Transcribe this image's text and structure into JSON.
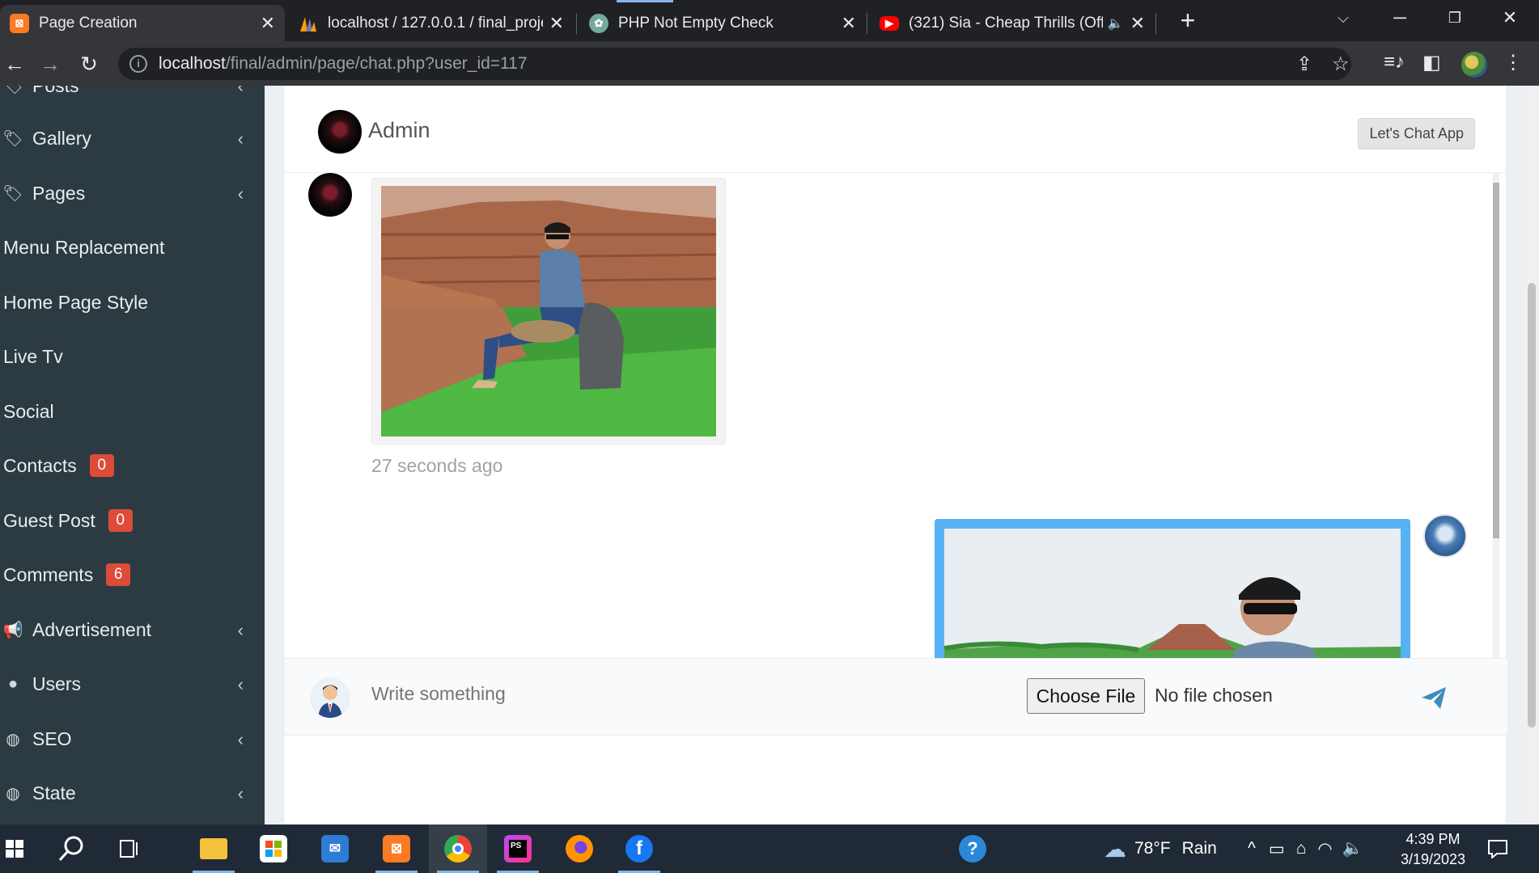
{
  "browser": {
    "tabs": [
      {
        "title": "Page Creation",
        "icon": "xampp-icon",
        "active": true
      },
      {
        "title": "localhost / 127.0.0.1 / final_projec",
        "icon": "phpmyadmin-icon",
        "active": false
      },
      {
        "title": "PHP Not Empty Check",
        "icon": "chatgpt-icon",
        "active": false
      },
      {
        "title": "(321) Sia - Cheap Thrills (Offi",
        "icon": "youtube-icon",
        "active": false,
        "audio": true
      }
    ],
    "address": {
      "host": "localhost",
      "path": "/final/admin/page/chat.php?user_id=117"
    }
  },
  "sidebar": {
    "items": [
      {
        "label": "Posts",
        "icon": "tag-icon",
        "chevron": true
      },
      {
        "label": "Gallery",
        "icon": "tag-icon",
        "chevron": true
      },
      {
        "label": "Pages",
        "icon": "tag-icon",
        "chevron": true
      },
      {
        "label": "Menu Replacement",
        "icon": "",
        "chevron": false
      },
      {
        "label": "Home Page Style",
        "icon": "",
        "chevron": false
      },
      {
        "label": "Live Tv",
        "icon": "",
        "chevron": false
      },
      {
        "label": "Social",
        "icon": "",
        "chevron": false
      },
      {
        "label": "Contacts",
        "icon": "",
        "badge": "0"
      },
      {
        "label": "Guest Post",
        "icon": "",
        "badge": "0"
      },
      {
        "label": "Comments",
        "icon": "",
        "badge": "6"
      },
      {
        "label": "Advertisement",
        "icon": "bullhorn-icon",
        "chevron": true
      },
      {
        "label": "Users",
        "icon": "user-circle-icon",
        "chevron": true
      },
      {
        "label": "SEO",
        "icon": "globe-icon",
        "chevron": true
      },
      {
        "label": "State",
        "icon": "globe-icon",
        "chevron": true
      }
    ]
  },
  "chat": {
    "header": {
      "name": "Admin",
      "app_button": "Let's Chat App"
    },
    "messages": [
      {
        "side": "left",
        "type": "image",
        "time": "27 seconds ago"
      },
      {
        "side": "right",
        "type": "image",
        "time": ""
      }
    ],
    "composer": {
      "placeholder": "Write something",
      "file_button": "Choose File",
      "file_status": "No file chosen"
    }
  },
  "taskbar": {
    "weather": {
      "temp": "78°F",
      "condition": "Rain"
    },
    "time": "4:39 PM",
    "date": "3/19/2023",
    "apps": [
      "file-explorer-icon",
      "microsoft-store-icon",
      "mail-icon",
      "xampp-icon",
      "chrome-icon",
      "phpstorm-icon",
      "firefox-icon",
      "facebook-icon"
    ]
  },
  "colors": {
    "sidebar_bg": "#2c3b41",
    "badge": "#dd4b39",
    "accent_blue": "#56b2f2",
    "send": "#3c8dbc"
  }
}
